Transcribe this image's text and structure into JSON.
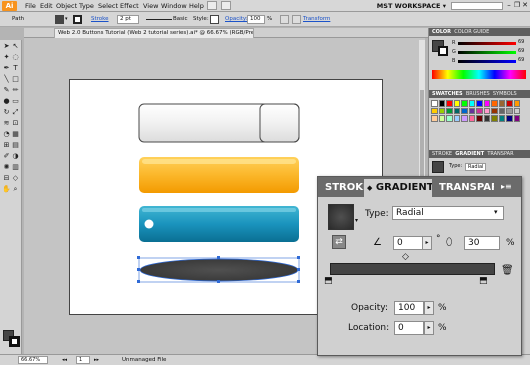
{
  "menubar": {
    "logo": "Ai",
    "items": [
      "File",
      "Edit",
      "Object",
      "Type",
      "Select",
      "Effect",
      "View",
      "Window",
      "Help"
    ],
    "workspace": "MST WORKSPACE ▾"
  },
  "control": {
    "selection": "Path",
    "stroke_label": "Stroke",
    "stroke_weight": "2 pt",
    "stroke_style": "Basic",
    "style_label": "Style:",
    "opacity_label": "Opacity:",
    "opacity_value": "100",
    "opacity_unit": "%",
    "transform_label": "Transform"
  },
  "document": {
    "tab": "Web 2.0 Buttons Tutorial (Web 2 tutorial series).ai* @ 66.67% (RGB/Preview)"
  },
  "status": {
    "zoom": "66.67%",
    "page": "1",
    "message": "Unmanaged File"
  },
  "color_panel": {
    "tabs": [
      "COLOR",
      "COLOR GUIDE"
    ],
    "r": "69",
    "g": "69",
    "b": "69"
  },
  "swatches_panel": {
    "tabs": [
      "SWATCHES",
      "BRUSHES",
      "SYMBOLS"
    ]
  },
  "mini_gradient": {
    "tabs": [
      "STROKE",
      "GRADIENT",
      "TRANSPAR"
    ],
    "type_label": "Type:",
    "type_value": "Radial"
  },
  "gradient_panel": {
    "tabs": [
      "STROKE",
      "GRADIENT",
      "TRANSPAR"
    ],
    "type_label": "Type:",
    "type_value": "Radial",
    "angle_value": "0",
    "angle_unit": "°",
    "aspect_value": "30",
    "aspect_unit": "%",
    "opacity_label": "Opacity:",
    "opacity_value": "100",
    "opacity_unit": "%",
    "location_label": "Location:",
    "location_value": "0",
    "location_unit": "%"
  },
  "colors": {
    "orange_top": "#ffd15a",
    "orange_bottom": "#f39a00",
    "blue_top": "#41b6d3",
    "blue_bottom": "#0a6f93",
    "gradient_dark": "#454545",
    "selection_blue": "#2f6ad6"
  }
}
